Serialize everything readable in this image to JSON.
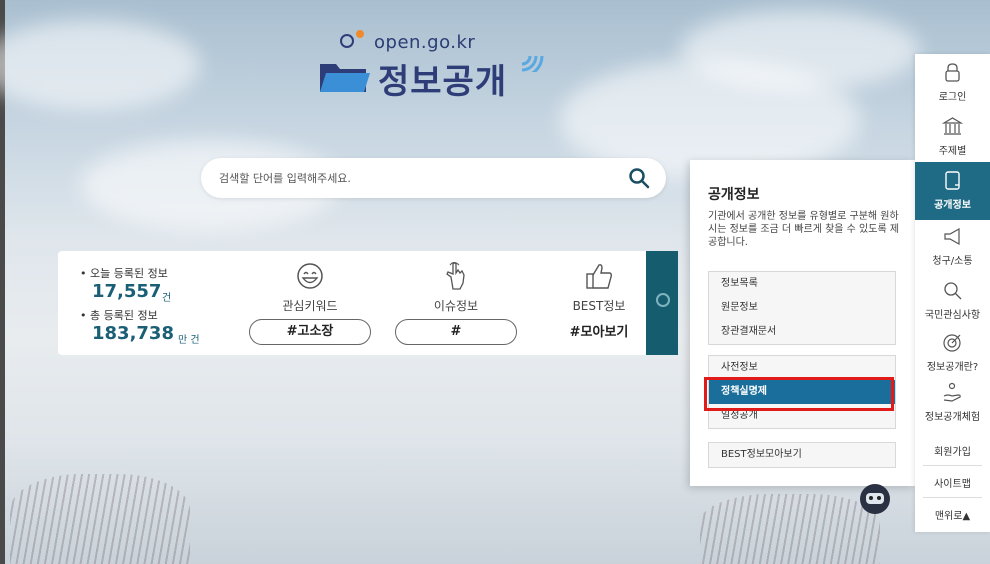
{
  "logo": {
    "url_text": "open.go.kr",
    "brand_text": "정보공개"
  },
  "search": {
    "placeholder": "검색할 단어를 입력해주세요."
  },
  "stats": {
    "today_label": "• 오늘 등록된 정보",
    "today_value": "17,557",
    "today_unit": "건",
    "total_label": "• 총 등록된 정보",
    "total_value": "183,738",
    "total_unit": "만 건"
  },
  "quick": [
    {
      "label": "관심키워드",
      "button": "#고소장",
      "icon": "smile-icon"
    },
    {
      "label": "이슈정보",
      "button": "#",
      "icon": "hand-pointer-icon"
    },
    {
      "label": "BEST정보",
      "button": "#모아보기",
      "icon": "thumbs-up-icon"
    }
  ],
  "panel": {
    "title": "공개정보",
    "description": "기관에서 공개한 정보를 유형별로 구분해 원하시는 정보를 조금 더 빠르게 찾을 수 있도록 제공합니다.",
    "group1": [
      "정보목록",
      "원문정보",
      "장관결재문서"
    ],
    "group2": [
      "사전정보",
      "정책실명제",
      "일정공개"
    ],
    "group3": [
      "BEST정보모아보기"
    ],
    "active_item": "정책실명제"
  },
  "sidebar": {
    "items": [
      {
        "label": "로그인",
        "icon": "lock-icon"
      },
      {
        "label": "주제별",
        "icon": "building-icon"
      },
      {
        "label": "공개정보",
        "icon": "document-icon"
      },
      {
        "label": "청구/소통",
        "icon": "megaphone-icon"
      },
      {
        "label": "국민관심사항",
        "icon": "search-icon"
      },
      {
        "label": "정보공개란?",
        "icon": "target-icon"
      },
      {
        "label": "정보공개체험",
        "icon": "hand-icon"
      }
    ],
    "links": [
      "회원가입",
      "사이트맵",
      "맨위로▲"
    ]
  },
  "colors": {
    "accent": "#1f6a85",
    "active_item": "#1a6e9c",
    "highlight": "#e11a1a"
  }
}
